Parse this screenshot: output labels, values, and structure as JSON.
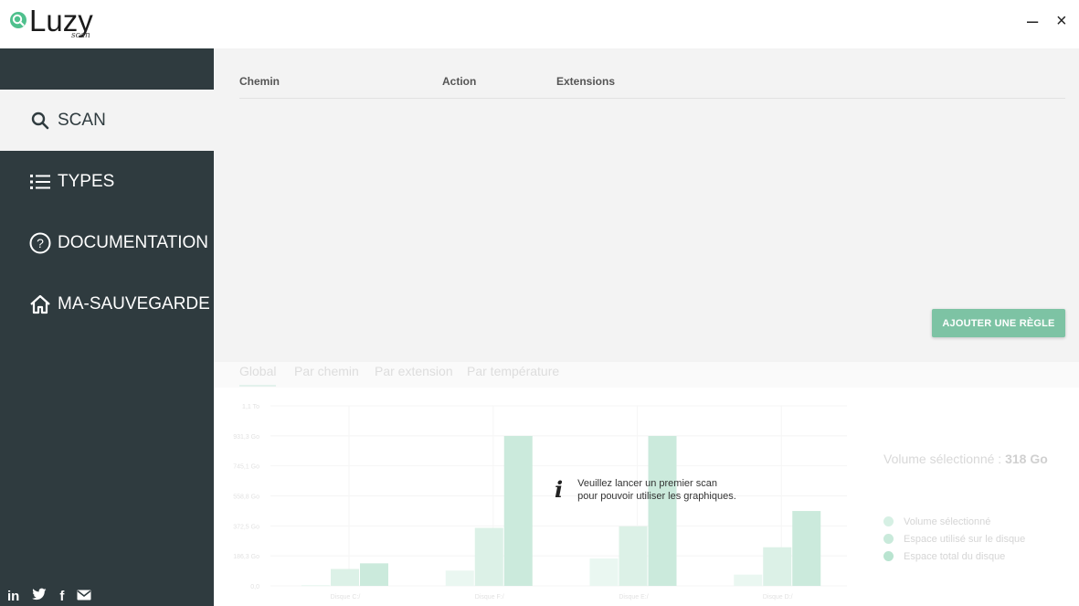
{
  "app": {
    "logo_text": "Luzy",
    "logo_sub": "scan",
    "minimize": "–",
    "close": "×"
  },
  "sidebar": {
    "items": [
      {
        "label": "SCAN",
        "icon": "search-icon",
        "active": true
      },
      {
        "label": "TYPES",
        "icon": "list-icon",
        "active": false
      },
      {
        "label": "DOCUMENTATION",
        "icon": "help-circle-icon",
        "active": false
      },
      {
        "label": "MA-SAUVEGARDE",
        "icon": "home-icon",
        "active": false
      }
    ],
    "social": {
      "linkedin": "in",
      "twitter": "🐦",
      "facebook": "f",
      "email": "✉"
    }
  },
  "rules": {
    "col_path": "Chemin",
    "col_action": "Action",
    "col_extensions": "Extensions",
    "add_button": "AJOUTER UNE RÈGLE"
  },
  "tabs": [
    {
      "label": "Global",
      "active": true
    },
    {
      "label": "Par chemin",
      "active": false
    },
    {
      "label": "Par extension",
      "active": false
    },
    {
      "label": "Par température",
      "active": false
    }
  ],
  "notice": {
    "line1": "Veuillez lancer un premier scan",
    "line2": "pour pouvoir utiliser les graphiques."
  },
  "volume": {
    "label": "Volume sélectionné : ",
    "value": "318 Go"
  },
  "legend": [
    {
      "label": "Volume sélectionné",
      "color": "#d6f0e4"
    },
    {
      "label": "Espace utilisé sur le disque",
      "color": "#c9eadb"
    },
    {
      "label": "Espace total du disque",
      "color": "#b9e4d0"
    }
  ],
  "chart_data": {
    "type": "bar",
    "y_tick_labels": [
      "1,1 To",
      "931,3 Go",
      "745,1 Go",
      "558,8 Go",
      "372,5 Go",
      "186,3 Go",
      "0,0"
    ],
    "categories": [
      "Disque C:/",
      "Disque F:/",
      "Disque E:/",
      "Disque D:/"
    ],
    "series": [
      {
        "name": "Volume sélectionné",
        "values": [
          5,
          95,
          170,
          70
        ],
        "color": "#eaf7f1"
      },
      {
        "name": "Espace utilisé sur le disque",
        "values": [
          105,
          360,
          370,
          240
        ],
        "color": "#dcf1e7"
      },
      {
        "name": "Espace total du disque",
        "values": [
          140,
          931,
          931,
          465
        ],
        "color": "#cbeadc"
      }
    ],
    "ylim": [
      0,
      1118
    ]
  }
}
